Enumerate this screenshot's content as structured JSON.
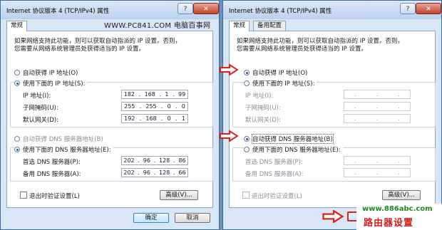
{
  "left": {
    "title": "Internet 协议版本 4 (TCP/IPv4) 属性",
    "help": "?",
    "close": "✕",
    "tabs": [
      "常规"
    ],
    "watermark": "WWW.PC841.COM 电脑百事网",
    "desc": [
      "如果网络支持此功能，则可以获取自动指派的 IP 设置。否则，",
      "您需要从网络系统管理员处获得适当的 IP 设置。"
    ],
    "auto_ip": "自动获得 IP 地址(O)",
    "manual_ip": "使用下面的 IP 地址(S):",
    "ip_label": "IP 地址(I):",
    "ip_value": [
      "182",
      "168",
      "1",
      "99"
    ],
    "mask_label": "子网掩码(U):",
    "mask_value": [
      "255",
      "255",
      "0",
      "0"
    ],
    "gw_label": "默认网关(D):",
    "gw_value": [
      "192",
      "168",
      "0",
      "1"
    ],
    "auto_dns": "自动获得 DNS 服务器地址(B)",
    "manual_dns": "使用下面的 DNS 服务器地址(E):",
    "dns1_label": "首选 DNS 服务器(P):",
    "dns1_value": [
      "202",
      "96",
      "128",
      "86"
    ],
    "dns2_label": "备用 DNS 服务器(A):",
    "dns2_value": [
      "202",
      "96",
      "128",
      "66"
    ],
    "validate": "退出时验证设置(L)",
    "advanced": "高级(V)...",
    "ok": "确定",
    "cancel": "取消"
  },
  "right": {
    "title": "Internet 协议版本 4 (TCP/IPv4) 属性",
    "help": "?",
    "close": "✕",
    "tabs": [
      "常规",
      "备用配置"
    ],
    "desc": [
      "如果网络支持此功能，则可以获取自动指派的 IP 设置。否则，",
      "您需要从网络系统管理员处获得适当的 IP 设置。"
    ],
    "auto_ip": "自动获得 IP 地址(O)",
    "manual_ip": "使用下面的 IP 地址(S):",
    "ip_label": "IP 地址(I):",
    "mask_label": "子网掩码(U):",
    "gw_label": "默认网关(D):",
    "auto_dns": "自动获得 DNS 服务器地址(B)",
    "manual_dns": "使用下面的 DNS 服务器地址(E):",
    "dns1_label": "首选 DNS 服务器(P):",
    "dns2_label": "备用 DNS 服务器(A):",
    "validate": "退出时验证设置(L)",
    "advanced": "高级(V)..."
  },
  "footer": {
    "url": "www.886abc.com",
    "brand": "路由器设置"
  },
  "colors": {
    "arrow": "#e0201b",
    "title_bg": "#bcd2ec",
    "watermark_green": "#1c8a2a",
    "watermark_red": "#d31c1c"
  }
}
